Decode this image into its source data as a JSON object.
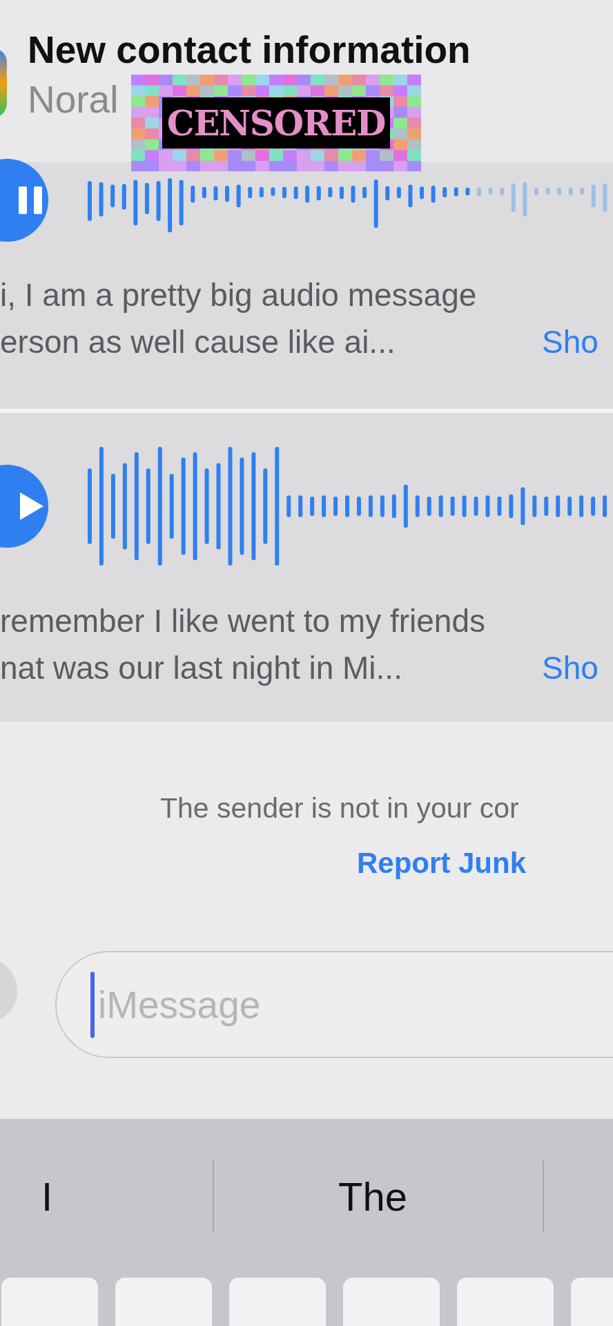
{
  "header": {
    "title": "New contact information",
    "subtitle": "Noral"
  },
  "censor_overlay": {
    "label": "CENSORED"
  },
  "audio_messages": [
    {
      "playing": true,
      "transcript": [
        "i, I am a pretty big audio message",
        "erson as well cause like ai..."
      ],
      "show_link": "Sho"
    },
    {
      "playing": false,
      "transcript": [
        "remember I like went to my friends",
        "nat was our last night in Mi..."
      ],
      "show_link": "Sho"
    }
  ],
  "notice": {
    "text": "The sender is not in your cor",
    "link": "Report Junk"
  },
  "message_field": {
    "placeholder": "iMessage"
  },
  "suggestions": [
    {
      "text": "I"
    },
    {
      "text": "The"
    }
  ]
}
